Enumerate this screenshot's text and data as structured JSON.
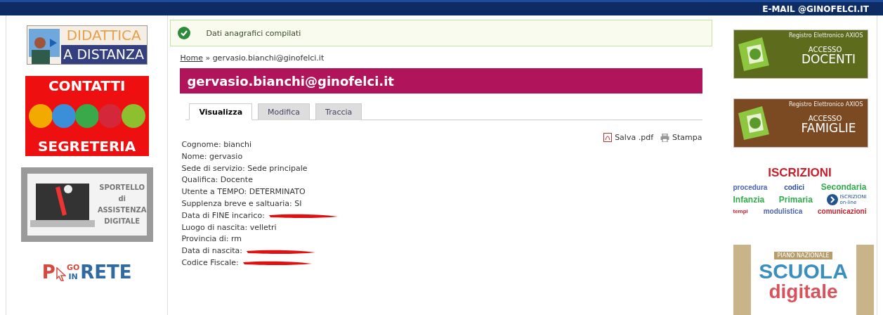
{
  "top_bar": {
    "email_link": "E-MAIL @GINOFELCI.IT"
  },
  "left_banners": {
    "didattica": {
      "line1": "DIDATTICA",
      "line2": "A DISTANZA"
    },
    "contatti": {
      "top": "CONTATTI",
      "bottom": "SEGRETERIA"
    },
    "sportello": {
      "lines": [
        "SPORTELLO",
        "di",
        "ASSISTENZA",
        "DIGITALE"
      ]
    },
    "pago": {
      "p": "P",
      "go": "GO",
      "in": "IN",
      "rete": "RETE"
    }
  },
  "message": {
    "text": "Dati anagrafici compilati"
  },
  "breadcrumb": {
    "home": "Home",
    "separator": "»",
    "current": "gervasio.bianchi@ginofelci.it"
  },
  "title": "gervasio.bianchi@ginofelci.it",
  "tabs": [
    {
      "label": "Visualizza",
      "selected": true
    },
    {
      "label": "Modifica",
      "selected": false
    },
    {
      "label": "Traccia",
      "selected": false
    }
  ],
  "actions": [
    {
      "kind": "pdf",
      "label": "Salva .pdf"
    },
    {
      "kind": "print",
      "label": "Stampa"
    }
  ],
  "fields": [
    {
      "label": "Cognome:",
      "value": "bianchi",
      "redacted": false
    },
    {
      "label": "Nome:",
      "value": "gervasio",
      "redacted": false
    },
    {
      "label": "Sede di servizio:",
      "value": "Sede principale",
      "redacted": false
    },
    {
      "label": "Qualifica:",
      "value": "Docente",
      "redacted": false
    },
    {
      "label": "Utente a TEMPO:",
      "value": "DETERMINATO",
      "redacted": false
    },
    {
      "label": "Supplenza breve e saltuaria:",
      "value": "SI",
      "redacted": false
    },
    {
      "label": "Data di FINE incarico:",
      "redacted": true
    },
    {
      "label": "Luogo di nascita:",
      "value": "velletri",
      "redacted": false
    },
    {
      "label": "Provincia di:",
      "value": "rm",
      "redacted": false
    },
    {
      "label": "Data di nascita:",
      "redacted": true
    },
    {
      "label": "Codice Fiscale:",
      "redacted": true
    }
  ],
  "right_banners": {
    "axios": [
      {
        "caption": "Registro Elettronico AXIOS",
        "line1": "ACCESSO",
        "line2": "DOCENTI",
        "color": "#5c6b1c"
      },
      {
        "caption": "Registro Elettronico AXIOS",
        "line1": "ACCESSO",
        "line2": "FAMIGLIE",
        "color": "#7b4a22"
      }
    ],
    "iscrizioni": {
      "title": "ISCRIZIONI",
      "rows": [
        [
          "procedura",
          "codici",
          "Secondaria"
        ],
        [
          "Infanzia",
          "Primaria"
        ],
        [
          "tempi",
          "modulistica",
          "comunicazioni"
        ]
      ],
      "badge": [
        "ISCRIZIONI",
        "on-line"
      ]
    },
    "scuola": {
      "top": "PIANO NAZIONALE",
      "main": "SCUOLA",
      "sub": "digitale"
    }
  }
}
